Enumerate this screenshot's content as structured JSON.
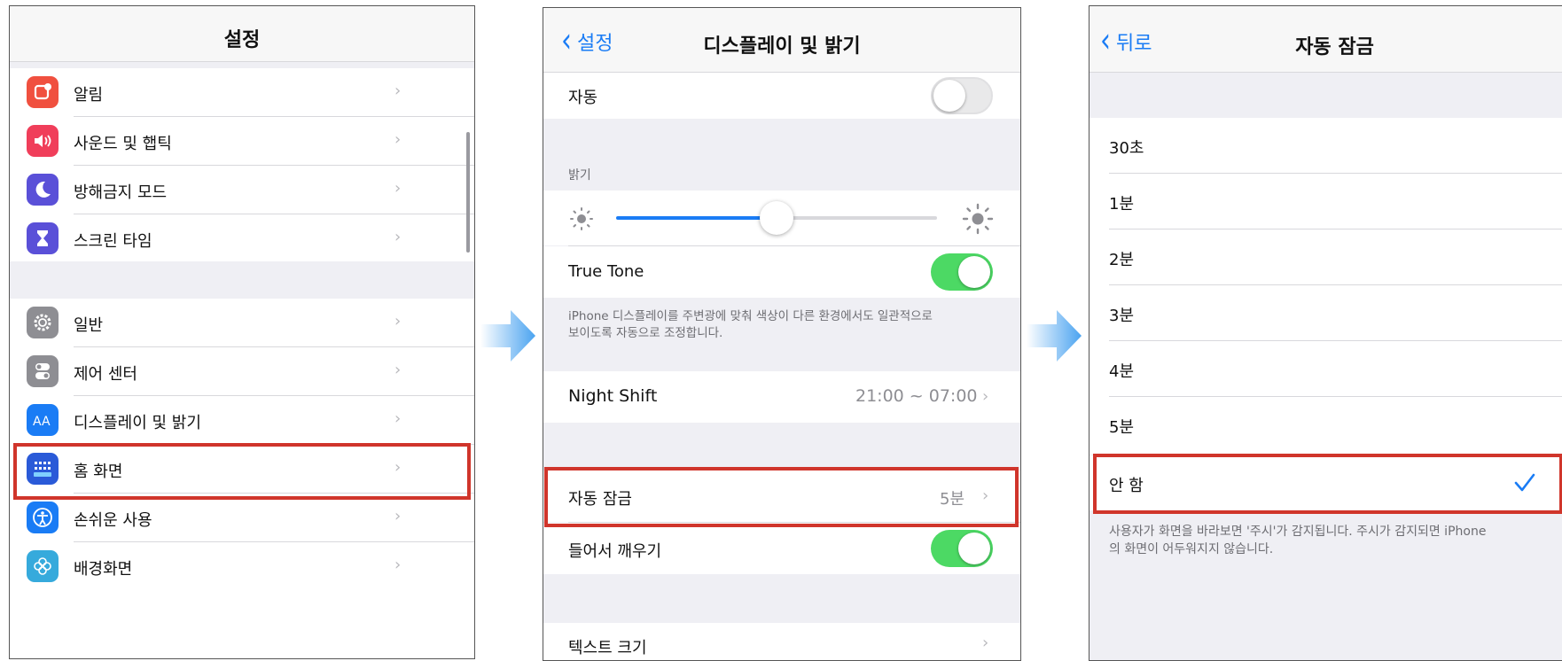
{
  "panel1": {
    "title": "설정",
    "items": [
      {
        "label": "알림",
        "icon": "notifications-icon",
        "color": "#f0503f"
      },
      {
        "label": "사운드 및 햅틱",
        "icon": "sound-icon",
        "color": "#f03e5a"
      },
      {
        "label": "방해금지 모드",
        "icon": "moon-icon",
        "color": "#5a50d8"
      },
      {
        "label": "스크린 타임",
        "icon": "hourglass-icon",
        "color": "#5a50d8"
      },
      {
        "label": "일반",
        "icon": "gear-icon",
        "color": "#8e8e93"
      },
      {
        "label": "제어 센터",
        "icon": "control-center-icon",
        "color": "#8e8e93"
      },
      {
        "label": "디스플레이 및 밝기",
        "icon": "display-aa-icon",
        "color": "#1a7cf5"
      },
      {
        "label": "홈 화면",
        "icon": "home-screen-icon",
        "color": "#2a5ad8"
      },
      {
        "label": "손쉬운 사용",
        "icon": "accessibility-icon",
        "color": "#1a7cf5"
      },
      {
        "label": "배경화면",
        "icon": "wallpaper-icon",
        "color": "#36aadc"
      }
    ]
  },
  "panel2": {
    "back_label": "설정",
    "title": "디스플레이 및 밝기",
    "auto_label": "자동",
    "brightness_header": "밝기",
    "brightness_level": 0.5,
    "true_tone_label": "True Tone",
    "true_tone_desc_line1": "iPhone 디스플레이를 주변광에 맞춰 색상이 다른 환경에서도 일관적으로",
    "true_tone_desc_line2": "보이도록 자동으로 조정합니다.",
    "night_shift_label": "Night Shift",
    "night_shift_value": "21:00 ~ 07:00",
    "auto_lock_label": "자동 잠금",
    "auto_lock_value": "5분",
    "raise_to_wake_label": "들어서 깨우기",
    "text_size_label": "텍스트 크기"
  },
  "panel3": {
    "back_label": "뒤로",
    "title": "자동 잠금",
    "options": [
      "30초",
      "1분",
      "2분",
      "3분",
      "4분",
      "5분",
      "안 함"
    ],
    "selected_option": "안 함",
    "footer_line1": "사용자가 화면을 바라보면 '주시'가 감지됩니다. 주시가 감지되면 iPhone",
    "footer_line2": "의 화면이 어두워지지 않습니다."
  },
  "colors": {
    "accent": "#1a7cf5",
    "highlight": "#d0352b",
    "toggle_on": "#4cd964",
    "arrow": "#4aa3f0"
  }
}
